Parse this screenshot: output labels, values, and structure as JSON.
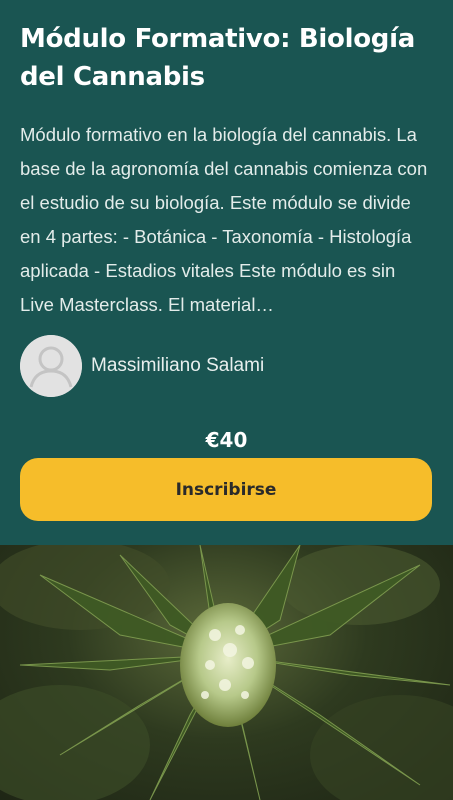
{
  "course": {
    "title": "Módulo Formativo: Biología del Cannabis",
    "description": "Módulo formativo en la biología del cannabis. La base de la agronomía del cannabis comienza con el estudio de su biología. Este módulo se divide en 4 partes: - Botánica - Taxonomía - Histología aplicada - Estadios vitales Este módulo es sin Live Masterclass. El material…",
    "instructor": "Massimiliano Salami",
    "price": "€40",
    "enroll_label": "Inscribirse"
  },
  "colors": {
    "card_background": "#1a5552",
    "button": "#f6bd2a",
    "title_text": "#ffffff"
  },
  "icons": {
    "avatar": "user-placeholder-icon"
  }
}
